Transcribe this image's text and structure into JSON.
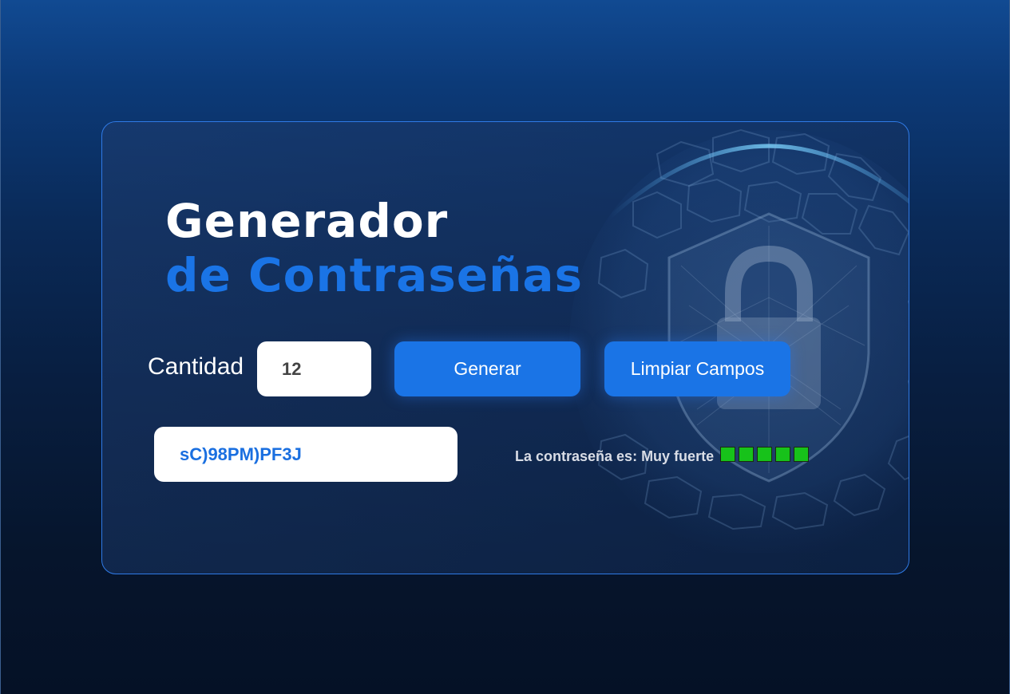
{
  "title": {
    "line1": "Generador",
    "line2": "de Contraseñas"
  },
  "controls": {
    "quantity_label": "Cantidad",
    "quantity_value": "12",
    "generate_label": "Generar",
    "clear_label": "Limpiar Campos"
  },
  "output": {
    "password": "sC)98PM)PF3J"
  },
  "strength": {
    "text": "La contraseña es: Muy fuerte",
    "filled": 5,
    "total": 5,
    "color": "#17c21a"
  },
  "background": {
    "icon": "shield-lock-globe-icon"
  },
  "colors": {
    "accent": "#1a74e6",
    "card_border": "#2f7ae6"
  }
}
